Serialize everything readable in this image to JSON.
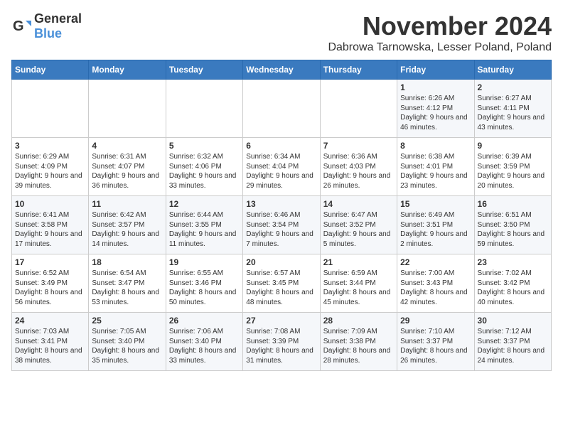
{
  "logo": {
    "text_general": "General",
    "text_blue": "Blue"
  },
  "title": {
    "month": "November 2024",
    "location": "Dabrowa Tarnowska, Lesser Poland, Poland"
  },
  "weekdays": [
    "Sunday",
    "Monday",
    "Tuesday",
    "Wednesday",
    "Thursday",
    "Friday",
    "Saturday"
  ],
  "weeks": [
    [
      {
        "day": "",
        "info": ""
      },
      {
        "day": "",
        "info": ""
      },
      {
        "day": "",
        "info": ""
      },
      {
        "day": "",
        "info": ""
      },
      {
        "day": "",
        "info": ""
      },
      {
        "day": "1",
        "info": "Sunrise: 6:26 AM\nSunset: 4:12 PM\nDaylight: 9 hours and 46 minutes."
      },
      {
        "day": "2",
        "info": "Sunrise: 6:27 AM\nSunset: 4:11 PM\nDaylight: 9 hours and 43 minutes."
      }
    ],
    [
      {
        "day": "3",
        "info": "Sunrise: 6:29 AM\nSunset: 4:09 PM\nDaylight: 9 hours and 39 minutes."
      },
      {
        "day": "4",
        "info": "Sunrise: 6:31 AM\nSunset: 4:07 PM\nDaylight: 9 hours and 36 minutes."
      },
      {
        "day": "5",
        "info": "Sunrise: 6:32 AM\nSunset: 4:06 PM\nDaylight: 9 hours and 33 minutes."
      },
      {
        "day": "6",
        "info": "Sunrise: 6:34 AM\nSunset: 4:04 PM\nDaylight: 9 hours and 29 minutes."
      },
      {
        "day": "7",
        "info": "Sunrise: 6:36 AM\nSunset: 4:03 PM\nDaylight: 9 hours and 26 minutes."
      },
      {
        "day": "8",
        "info": "Sunrise: 6:38 AM\nSunset: 4:01 PM\nDaylight: 9 hours and 23 minutes."
      },
      {
        "day": "9",
        "info": "Sunrise: 6:39 AM\nSunset: 3:59 PM\nDaylight: 9 hours and 20 minutes."
      }
    ],
    [
      {
        "day": "10",
        "info": "Sunrise: 6:41 AM\nSunset: 3:58 PM\nDaylight: 9 hours and 17 minutes."
      },
      {
        "day": "11",
        "info": "Sunrise: 6:42 AM\nSunset: 3:57 PM\nDaylight: 9 hours and 14 minutes."
      },
      {
        "day": "12",
        "info": "Sunrise: 6:44 AM\nSunset: 3:55 PM\nDaylight: 9 hours and 11 minutes."
      },
      {
        "day": "13",
        "info": "Sunrise: 6:46 AM\nSunset: 3:54 PM\nDaylight: 9 hours and 7 minutes."
      },
      {
        "day": "14",
        "info": "Sunrise: 6:47 AM\nSunset: 3:52 PM\nDaylight: 9 hours and 5 minutes."
      },
      {
        "day": "15",
        "info": "Sunrise: 6:49 AM\nSunset: 3:51 PM\nDaylight: 9 hours and 2 minutes."
      },
      {
        "day": "16",
        "info": "Sunrise: 6:51 AM\nSunset: 3:50 PM\nDaylight: 8 hours and 59 minutes."
      }
    ],
    [
      {
        "day": "17",
        "info": "Sunrise: 6:52 AM\nSunset: 3:49 PM\nDaylight: 8 hours and 56 minutes."
      },
      {
        "day": "18",
        "info": "Sunrise: 6:54 AM\nSunset: 3:47 PM\nDaylight: 8 hours and 53 minutes."
      },
      {
        "day": "19",
        "info": "Sunrise: 6:55 AM\nSunset: 3:46 PM\nDaylight: 8 hours and 50 minutes."
      },
      {
        "day": "20",
        "info": "Sunrise: 6:57 AM\nSunset: 3:45 PM\nDaylight: 8 hours and 48 minutes."
      },
      {
        "day": "21",
        "info": "Sunrise: 6:59 AM\nSunset: 3:44 PM\nDaylight: 8 hours and 45 minutes."
      },
      {
        "day": "22",
        "info": "Sunrise: 7:00 AM\nSunset: 3:43 PM\nDaylight: 8 hours and 42 minutes."
      },
      {
        "day": "23",
        "info": "Sunrise: 7:02 AM\nSunset: 3:42 PM\nDaylight: 8 hours and 40 minutes."
      }
    ],
    [
      {
        "day": "24",
        "info": "Sunrise: 7:03 AM\nSunset: 3:41 PM\nDaylight: 8 hours and 38 minutes."
      },
      {
        "day": "25",
        "info": "Sunrise: 7:05 AM\nSunset: 3:40 PM\nDaylight: 8 hours and 35 minutes."
      },
      {
        "day": "26",
        "info": "Sunrise: 7:06 AM\nSunset: 3:40 PM\nDaylight: 8 hours and 33 minutes."
      },
      {
        "day": "27",
        "info": "Sunrise: 7:08 AM\nSunset: 3:39 PM\nDaylight: 8 hours and 31 minutes."
      },
      {
        "day": "28",
        "info": "Sunrise: 7:09 AM\nSunset: 3:38 PM\nDaylight: 8 hours and 28 minutes."
      },
      {
        "day": "29",
        "info": "Sunrise: 7:10 AM\nSunset: 3:37 PM\nDaylight: 8 hours and 26 minutes."
      },
      {
        "day": "30",
        "info": "Sunrise: 7:12 AM\nSunset: 3:37 PM\nDaylight: 8 hours and 24 minutes."
      }
    ]
  ]
}
